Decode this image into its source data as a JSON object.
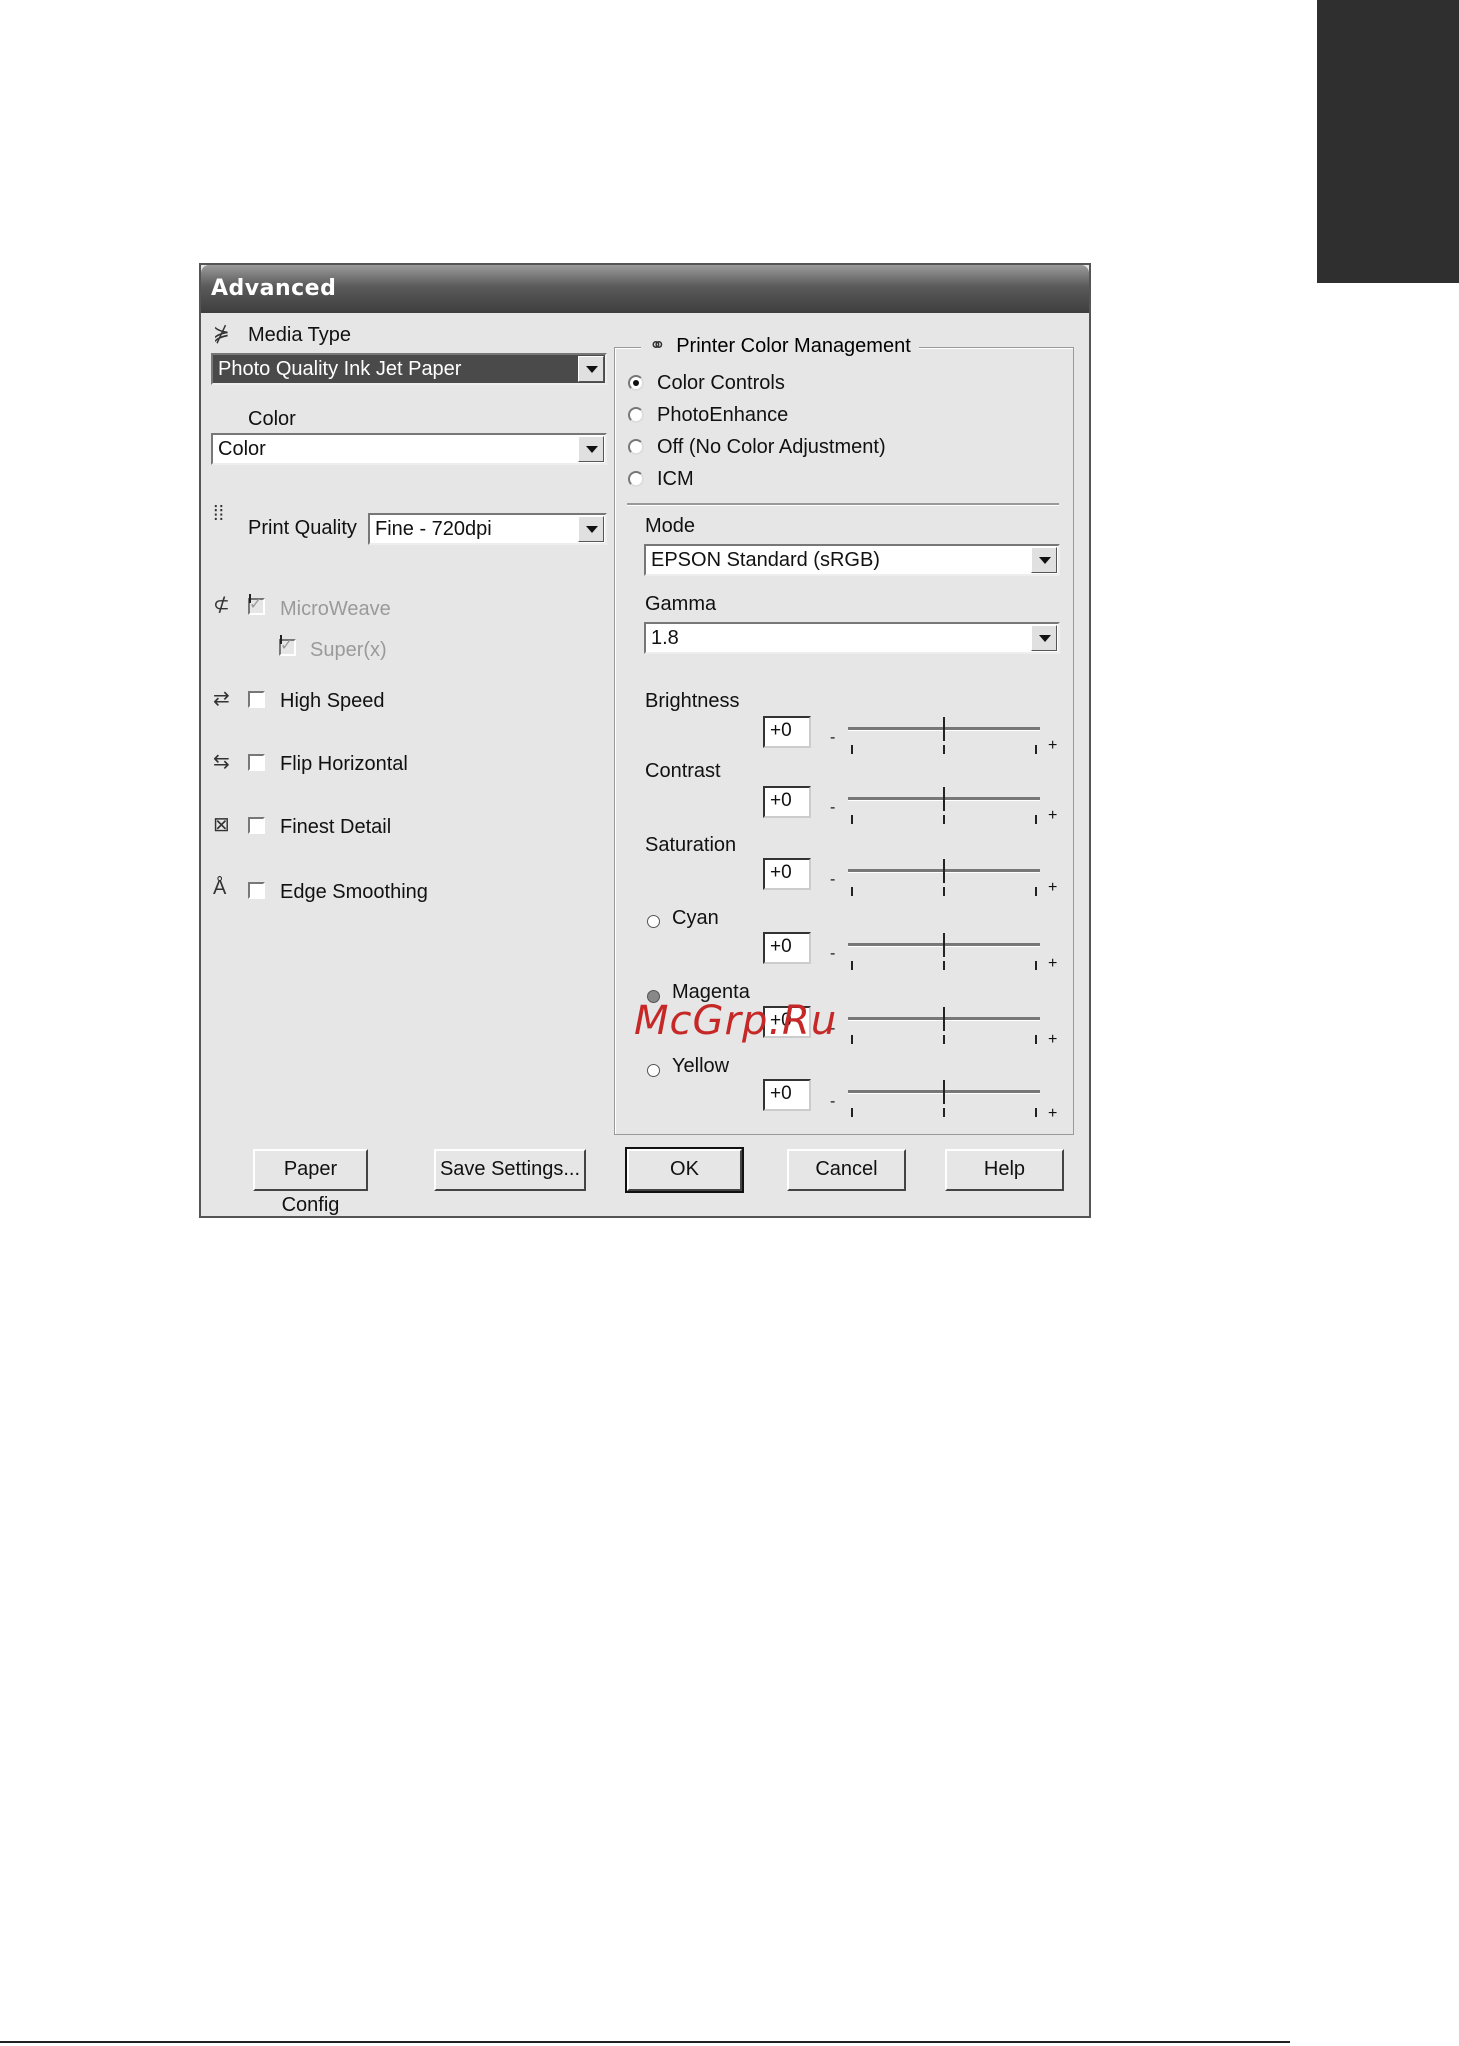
{
  "dialog": {
    "title": "Advanced",
    "media_type": {
      "label": "Media Type",
      "value": "Photo Quality Ink Jet Paper"
    },
    "color": {
      "label": "Color",
      "value": "Color"
    },
    "print_quality": {
      "label": "Print Quality",
      "value": "Fine - 720dpi"
    },
    "options": {
      "microweave": {
        "label": "MicroWeave",
        "checked": true,
        "enabled": false
      },
      "super": {
        "label": "Super(x)",
        "checked": true,
        "enabled": false
      },
      "high_speed": {
        "label": "High Speed",
        "checked": false
      },
      "flip_horizontal": {
        "label": "Flip Horizontal",
        "checked": false
      },
      "finest_detail": {
        "label": "Finest Detail",
        "checked": false
      },
      "edge_smoothing": {
        "label": "Edge Smoothing",
        "checked": false
      }
    },
    "color_management": {
      "title": "Printer Color Management",
      "radios": {
        "color_controls": "Color Controls",
        "photo_enhance": "PhotoEnhance",
        "off": "Off (No Color Adjustment)",
        "icm": "ICM"
      },
      "selected": "Color Controls",
      "mode": {
        "label": "Mode",
        "value": "EPSON Standard (sRGB)"
      },
      "gamma": {
        "label": "Gamma",
        "value": "1.8"
      },
      "sliders": {
        "brightness": {
          "label": "Brightness",
          "value": "+0"
        },
        "contrast": {
          "label": "Contrast",
          "value": "+0"
        },
        "saturation": {
          "label": "Saturation",
          "value": "+0"
        },
        "cyan": {
          "label": "Cyan",
          "value": "+0"
        },
        "magenta": {
          "label": "Magenta",
          "value": "+0"
        },
        "yellow": {
          "label": "Yellow",
          "value": "+0"
        }
      },
      "minus": "-",
      "plus": "+"
    },
    "buttons": {
      "paper_config": "Paper Config",
      "save_settings": "Save Settings...",
      "ok": "OK",
      "cancel": "Cancel",
      "help": "Help"
    }
  },
  "watermark": "McGrp.Ru"
}
